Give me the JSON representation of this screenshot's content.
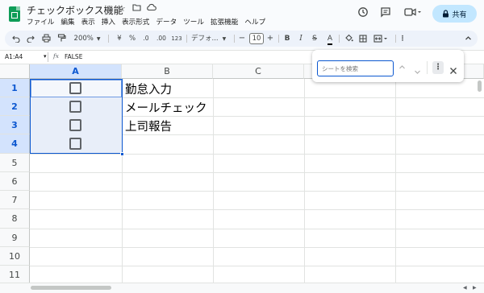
{
  "app": {
    "doc_title": "チェックボックス機能",
    "menu": [
      "ファイル",
      "編集",
      "表示",
      "挿入",
      "表示形式",
      "データ",
      "ツール",
      "拡張機能",
      "ヘルプ"
    ],
    "share_label": "共有"
  },
  "toolbar": {
    "zoom": "200%",
    "currency": "¥",
    "percent": "%",
    "dec_decrease": ".0",
    "dec_increase": ".00",
    "format_123": "123",
    "font": "デフォ...",
    "font_size": "10",
    "minus": "−",
    "plus": "+",
    "bold": "B",
    "italic": "I",
    "strike": "S",
    "text_color": "A"
  },
  "formula_bar": {
    "name_box": "A1:A4",
    "fx": "fx",
    "value": "FALSE"
  },
  "sheet": {
    "columns": [
      "A",
      "B",
      "C"
    ],
    "rows": [
      "1",
      "2",
      "3",
      "4",
      "5",
      "6",
      "7",
      "8",
      "9",
      "10",
      "11"
    ],
    "b_values": [
      "勤怠入力",
      "メールチェック",
      "上司報告"
    ],
    "checkbox_states": [
      false,
      false,
      false,
      false
    ]
  },
  "find": {
    "placeholder": "シートを検索"
  },
  "colors": {
    "accent": "#0b57d0",
    "selection": "#e8eef9",
    "header_selected": "#d3e3fd",
    "share_bg": "#c2e7ff"
  }
}
